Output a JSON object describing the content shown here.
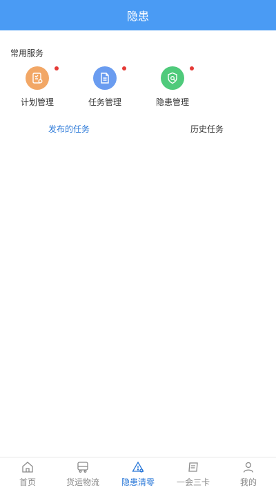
{
  "header": {
    "title": "隐患"
  },
  "section": {
    "title": "常用服务"
  },
  "services": [
    {
      "label": "计划管理",
      "icon": "plan-icon",
      "color": "#f2a766"
    },
    {
      "label": "任务管理",
      "icon": "task-icon",
      "color": "#6a9cf0"
    },
    {
      "label": "隐患管理",
      "icon": "hazard-shield-icon",
      "color": "#4fca7b"
    }
  ],
  "badge_color": "#e53935",
  "tabs": [
    {
      "label": "发布的任务",
      "active": true
    },
    {
      "label": "历史任务",
      "active": false
    }
  ],
  "bottom_nav": [
    {
      "label": "首页",
      "icon": "home-icon"
    },
    {
      "label": "货运物流",
      "icon": "truck-icon"
    },
    {
      "label": "隐患清零",
      "icon": "warning-icon",
      "active": true
    },
    {
      "label": "一会三卡",
      "icon": "cards-icon"
    },
    {
      "label": "我的",
      "icon": "user-icon"
    }
  ],
  "colors": {
    "primary": "#4a9bf4",
    "active": "#2a78d8",
    "inactive": "#8a8a8a"
  }
}
